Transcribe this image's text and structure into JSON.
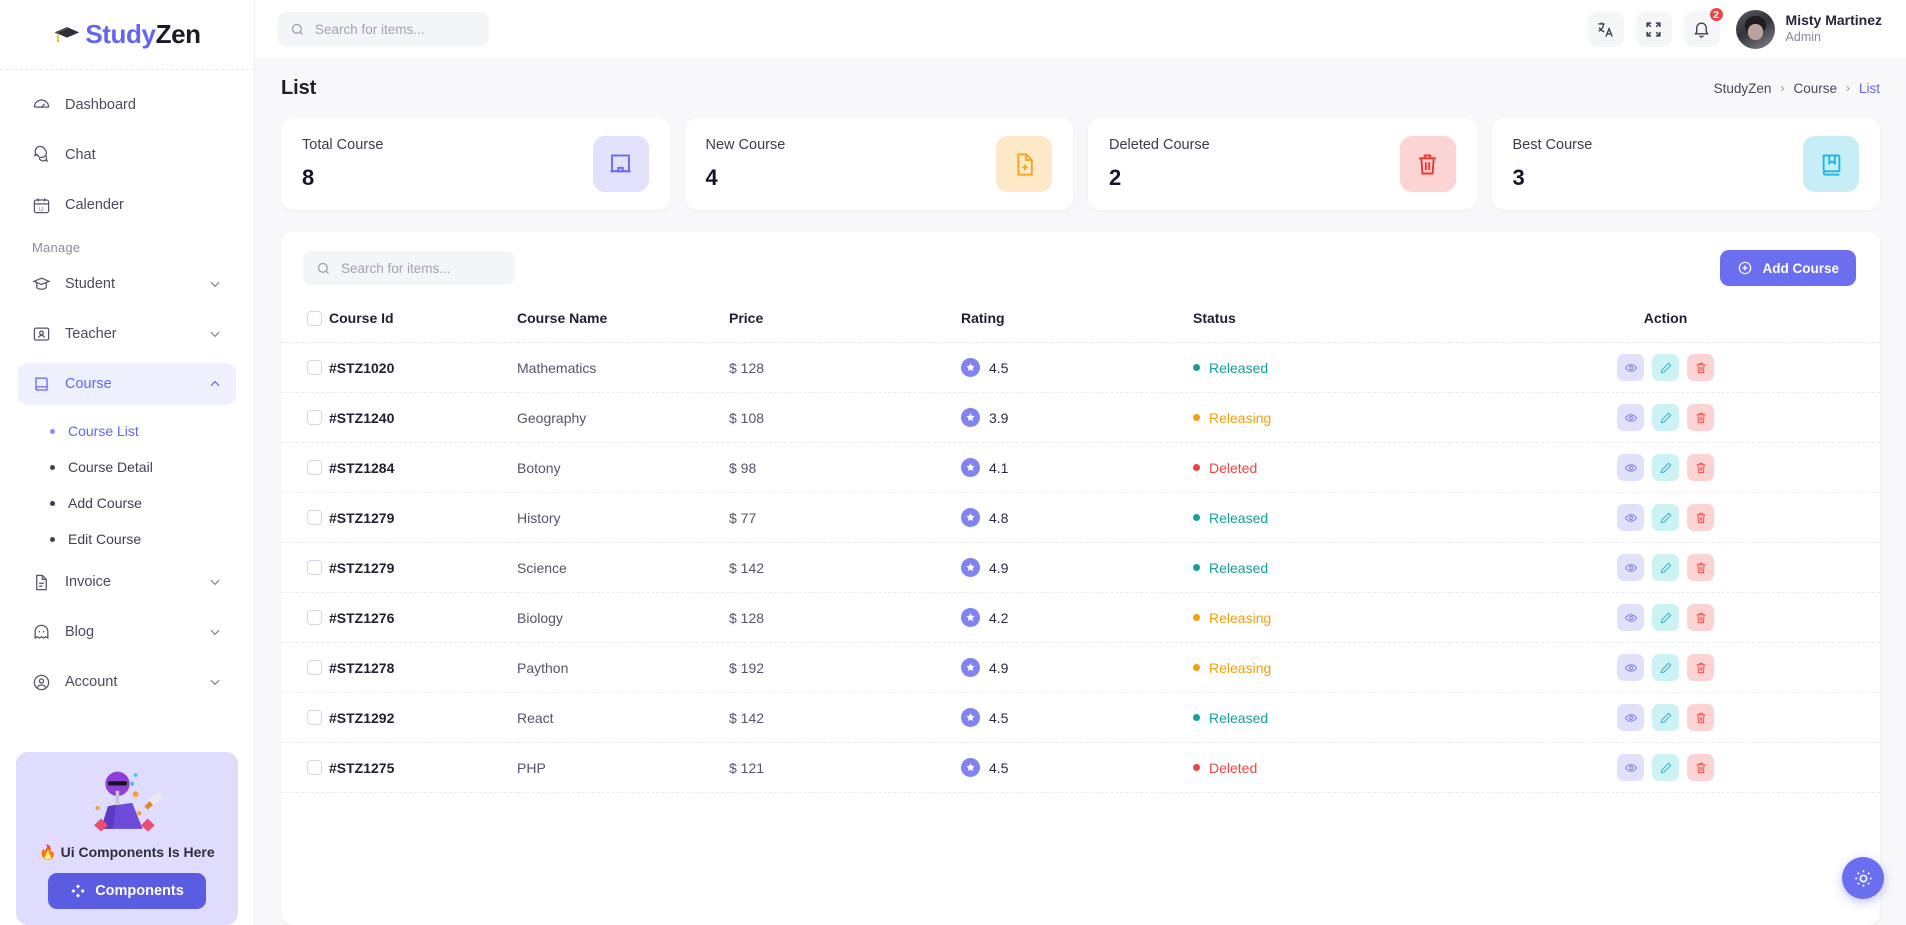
{
  "brand": {
    "name_part1": "Study",
    "name_part2": "Zen",
    "cap_icon": "graduation-cap-icon"
  },
  "sidebar": {
    "items": [
      {
        "label": "Dashboard",
        "icon": "gauge-icon",
        "expandable": false,
        "active": false
      },
      {
        "label": "Chat",
        "icon": "chat-bubbles-icon",
        "expandable": false,
        "active": false
      },
      {
        "label": "Calender",
        "icon": "calendar-icon",
        "expandable": false,
        "active": false
      }
    ],
    "section_label": "Manage",
    "manage_items": [
      {
        "label": "Student",
        "icon": "student-cap-icon",
        "expandable": true,
        "active": false
      },
      {
        "label": "Teacher",
        "icon": "teacher-board-icon",
        "expandable": true,
        "active": false
      },
      {
        "label": "Course",
        "icon": "book-icon",
        "expandable": true,
        "active": true
      }
    ],
    "course_children": [
      {
        "label": "Course List",
        "active": true
      },
      {
        "label": "Course Detail",
        "active": false
      },
      {
        "label": "Add Course",
        "active": false
      },
      {
        "label": "Edit Course",
        "active": false
      }
    ],
    "tail_items": [
      {
        "label": "Invoice",
        "icon": "file-icon",
        "expandable": true,
        "active": false
      },
      {
        "label": "Blog",
        "icon": "ghost-icon",
        "expandable": true,
        "active": false
      },
      {
        "label": "Account",
        "icon": "user-circle-icon",
        "expandable": true,
        "active": false
      }
    ],
    "promo": {
      "title": "🔥 Ui Components Is Here",
      "button_label": "Components",
      "button_icon": "components-diamond-icon"
    }
  },
  "topbar": {
    "search_placeholder": "Search for items...",
    "search_value": "",
    "search_icon": "search-icon",
    "translate_icon": "translate-icon",
    "fullscreen_icon": "fullscreen-icon",
    "bell_icon": "bell-icon",
    "notification_count": "2",
    "user": {
      "name": "Misty Martinez",
      "role": "Admin"
    }
  },
  "page": {
    "title": "List",
    "breadcrumb": [
      {
        "label": "StudyZen",
        "current": false
      },
      {
        "label": "Course",
        "current": false
      },
      {
        "label": "List",
        "current": true
      }
    ],
    "breadcrumb_separator": "›"
  },
  "stats": [
    {
      "title": "Total Course",
      "value": "8",
      "icon": "presentation-board-icon",
      "icon_color": "#6b6df0",
      "icon_bg": "#e3e2fc"
    },
    {
      "title": "New Course",
      "value": "4",
      "icon": "file-plus-icon",
      "icon_color": "#f5a623",
      "icon_bg": "#fde9c8"
    },
    {
      "title": "Deleted Course",
      "value": "2",
      "icon": "trash-icon",
      "icon_color": "#f4342f",
      "icon_bg": "#fbd4d3"
    },
    {
      "title": "Best Course",
      "value": "3",
      "icon": "bookmark-book-icon",
      "icon_color": "#22b8e0",
      "icon_bg": "#c7eef7"
    }
  ],
  "table_toolbar": {
    "search_placeholder": "Search for items...",
    "search_value": "",
    "search_icon": "search-icon",
    "add_button_label": "Add Course",
    "add_button_icon": "plus-circle-icon"
  },
  "table": {
    "columns": [
      "Course Id",
      "Course Name",
      "Price",
      "Rating",
      "Status",
      "Action"
    ],
    "select_all_checked": false,
    "row_actions": [
      {
        "name": "view",
        "icon": "eye-icon"
      },
      {
        "name": "edit",
        "icon": "pencil-icon"
      },
      {
        "name": "delete",
        "icon": "trash-icon"
      }
    ],
    "status_colors": {
      "Released": "#14a098",
      "Releasing": "#f59e0b",
      "Deleted": "#ef4444"
    },
    "rows": [
      {
        "id": "#STZ1020",
        "name": "Mathematics",
        "price": "$ 128",
        "rating": "4.5",
        "status": "Released"
      },
      {
        "id": "#STZ1240",
        "name": "Geography",
        "price": "$ 108",
        "rating": "3.9",
        "status": "Releasing"
      },
      {
        "id": "#STZ1284",
        "name": "Botony",
        "price": "$ 98",
        "rating": "4.1",
        "status": "Deleted"
      },
      {
        "id": "#STZ1279",
        "name": "History",
        "price": "$ 77",
        "rating": "4.8",
        "status": "Released"
      },
      {
        "id": "#STZ1279",
        "name": "Science",
        "price": "$ 142",
        "rating": "4.9",
        "status": "Released"
      },
      {
        "id": "#STZ1276",
        "name": "Biology",
        "price": "$ 128",
        "rating": "4.2",
        "status": "Releasing"
      },
      {
        "id": "#STZ1278",
        "name": "Paython",
        "price": "$ 192",
        "rating": "4.9",
        "status": "Releasing"
      },
      {
        "id": "#STZ1292",
        "name": "React",
        "price": "$ 142",
        "rating": "4.5",
        "status": "Released"
      },
      {
        "id": "#STZ1275",
        "name": "PHP",
        "price": "$ 121",
        "rating": "4.5",
        "status": "Deleted"
      }
    ]
  },
  "theme_toggle": {
    "icon": "sun-icon"
  },
  "colors": {
    "accent": "#6366f1",
    "accent_btn": "#6c6ef0",
    "page_bg": "#f8f8fb"
  }
}
